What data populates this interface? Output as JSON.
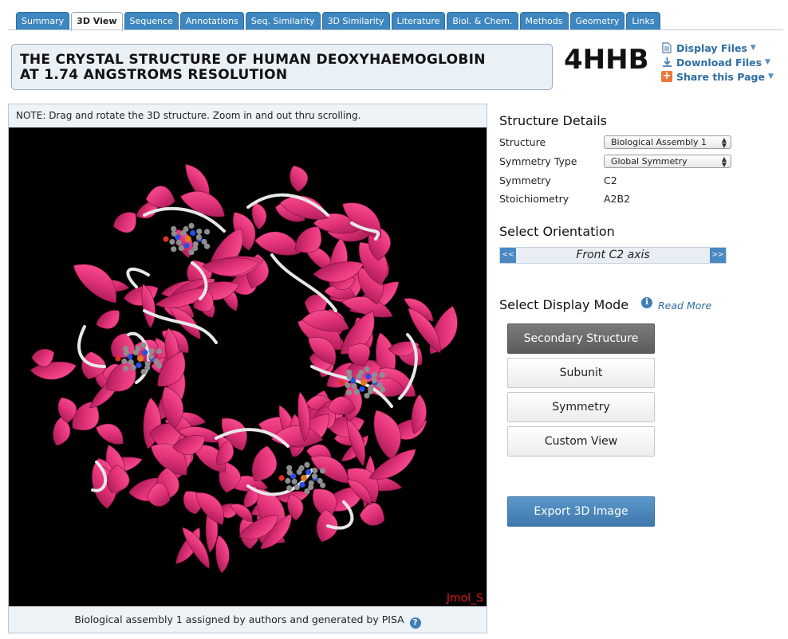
{
  "tabs": [
    {
      "label": "Summary"
    },
    {
      "label": "3D View",
      "active": true
    },
    {
      "label": "Sequence"
    },
    {
      "label": "Annotations"
    },
    {
      "label": "Seq. Similarity"
    },
    {
      "label": "3D Similarity"
    },
    {
      "label": "Literature"
    },
    {
      "label": "Biol. & Chem."
    },
    {
      "label": "Methods"
    },
    {
      "label": "Geometry"
    },
    {
      "label": "Links"
    }
  ],
  "header": {
    "title_line1": "THE CRYSTAL STRUCTURE OF HUMAN DEOXYHAEMOGLOBIN",
    "title_line2": "AT 1.74 ANGSTROMS RESOLUTION",
    "pdb_id": "4HHB",
    "links": {
      "display_files": "Display Files",
      "download_files": "Download Files",
      "share_page": "Share this Page"
    }
  },
  "viewer": {
    "note": "NOTE: Drag and rotate the 3D structure. Zoom in and out thru scrolling.",
    "jmol_label": "Jmol_S",
    "caption": "Biological assembly 1 assigned by authors and generated by PISA",
    "help_glyph": "?"
  },
  "structure_details": {
    "heading": "Structure Details",
    "structure_label": "Structure",
    "structure_value": "Biological Assembly 1",
    "symmetry_type_label": "Symmetry Type",
    "symmetry_type_value": "Global Symmetry",
    "symmetry_label": "Symmetry",
    "symmetry_value": "C2",
    "stoichiometry_label": "Stoichiometry",
    "stoichiometry_value": "A2B2"
  },
  "orientation": {
    "heading": "Select Orientation",
    "prev_glyph": "<<",
    "next_glyph": ">>",
    "current": "Front C2 axis"
  },
  "display_mode": {
    "heading": "Select Display Mode",
    "info_glyph": "i",
    "read_more": "Read More",
    "modes": [
      {
        "label": "Secondary Structure",
        "active": true
      },
      {
        "label": "Subunit"
      },
      {
        "label": "Symmetry"
      },
      {
        "label": "Custom View"
      }
    ],
    "export_label": "Export 3D Image"
  },
  "colors": {
    "tab_blue": "#3d86bf",
    "link_blue": "#2d6da3",
    "helix_pink": "#e3337a",
    "coil_white": "#e6e6e6",
    "export_blue": "#4a86bd",
    "active_grey": "#6a6a6a"
  },
  "icons": {
    "display_files": "document-icon",
    "download_files": "download-icon",
    "share_page": "plus-icon"
  }
}
